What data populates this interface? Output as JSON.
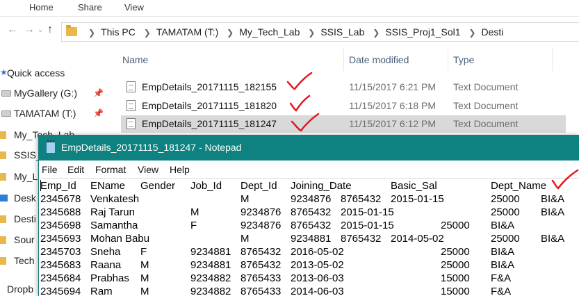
{
  "ribbon": {
    "tabs": [
      "Home",
      "Share",
      "View"
    ]
  },
  "address": {
    "crumbs": [
      "This PC",
      "TAMATAM (T:)",
      "My_Tech_Lab",
      "SSIS_Lab",
      "SSIS_Proj1_Sol1",
      "Desti"
    ]
  },
  "nav": {
    "quick_access": "Quick access",
    "items": [
      "MyGallery (G:)",
      "TAMATAM (T:)",
      "My_Tech_Lab",
      "SSIS_",
      "My_L",
      "Desk",
      "Desti",
      "Sour",
      "Tech",
      "Dropb"
    ]
  },
  "filelist": {
    "columns": [
      "Name",
      "Date modified",
      "Type"
    ],
    "rows": [
      {
        "name": "EmpDetails_20171115_182155",
        "date": "11/15/2017 6:21 PM",
        "type": "Text Document"
      },
      {
        "name": "EmpDetails_20171115_181820",
        "date": "11/15/2017 6:18 PM",
        "type": "Text Document"
      },
      {
        "name": "EmpDetails_20171115_181247",
        "date": "11/15/2017 6:12 PM",
        "type": "Text Document"
      }
    ]
  },
  "notepad": {
    "title": "EmpDetails_20171115_181247 - Notepad",
    "menu": [
      "File",
      "Edit",
      "Format",
      "View",
      "Help"
    ],
    "header": [
      "Emp_Id",
      "EName",
      "Gender",
      "Job_Id",
      "Dept_Id",
      "Joining_Date",
      "Basic_Sal",
      "Dept_Name"
    ],
    "lines": [
      [
        "2345678",
        "Venkatesh",
        "",
        "M",
        "9234876",
        "8765432",
        "2015-01-15",
        "25000",
        "BI&A"
      ],
      [
        "2345688",
        "Raj Tarun",
        "M",
        "9234876",
        "8765432",
        "2015-01-15",
        "",
        "25000",
        "BI&A"
      ],
      [
        "2345698",
        "Samantha",
        "",
        "F",
        "9234876",
        "8765432",
        "2015-01-15",
        "25000",
        "BI&A"
      ],
      [
        "2345693",
        "Mohan Babu",
        "",
        "M",
        "9234881",
        "8765432",
        "2014-05-02",
        "25000",
        "BI&A"
      ],
      [
        "2345703",
        "Sneha",
        "F",
        "9234881",
        "8765432",
        "2016-05-02",
        "",
        "25000",
        "BI&A"
      ],
      [
        "2345683",
        "Raana",
        "M",
        "9234881",
        "8765432",
        "2013-05-02",
        "",
        "25000",
        "BI&A"
      ],
      [
        "2345684",
        "Prabhas",
        "M",
        "9234882",
        "8765433",
        "2013-06-03",
        "",
        "15000",
        "F&A"
      ],
      [
        "2345694",
        "Ram",
        "M",
        "9234882",
        "8765433",
        "2014-06-03",
        "",
        "15000",
        "F&A"
      ]
    ]
  },
  "colors": {
    "notepad_title": "#0e8181",
    "annotation": "#e8141c",
    "selected_row": "#d9d9d9"
  }
}
